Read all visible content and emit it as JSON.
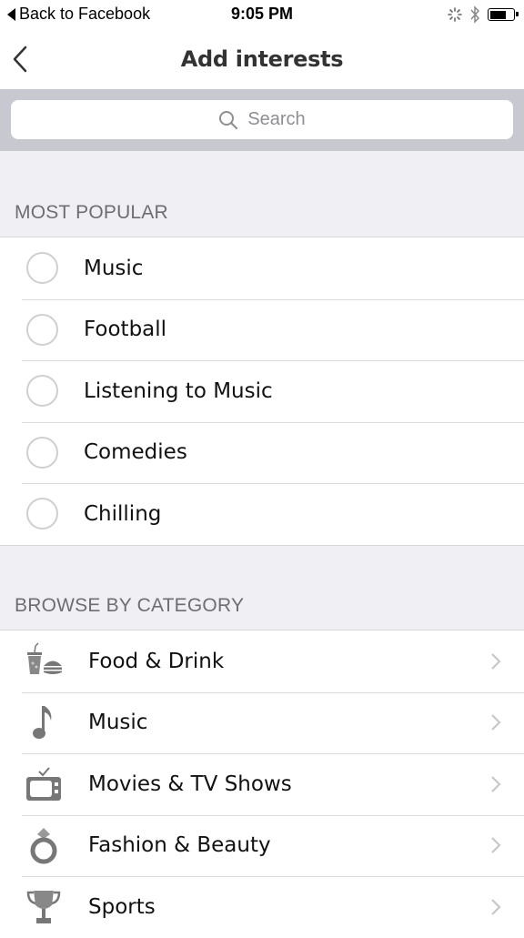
{
  "status_bar": {
    "back_app_label": "Back to Facebook",
    "time": "9:05 PM",
    "icons": [
      "activity-spinner-icon",
      "bluetooth-icon",
      "battery-icon"
    ]
  },
  "nav": {
    "back_icon": "chevron-left-icon",
    "title": "Add interests"
  },
  "search": {
    "placeholder": "Search",
    "icon": "search-icon"
  },
  "sections": {
    "most_popular": {
      "header": "MOST POPULAR",
      "items": [
        {
          "label": "Music",
          "selected": false
        },
        {
          "label": "Football",
          "selected": false
        },
        {
          "label": "Listening to Music",
          "selected": false
        },
        {
          "label": "Comedies",
          "selected": false
        },
        {
          "label": "Chilling",
          "selected": false
        }
      ]
    },
    "browse_by_category": {
      "header": "BROWSE BY CATEGORY",
      "items": [
        {
          "label": "Food & Drink",
          "icon": "food-drink-icon"
        },
        {
          "label": "Music",
          "icon": "music-note-icon"
        },
        {
          "label": "Movies & TV Shows",
          "icon": "tv-icon"
        },
        {
          "label": "Fashion & Beauty",
          "icon": "ring-icon"
        },
        {
          "label": "Sports",
          "icon": "trophy-icon"
        }
      ]
    }
  },
  "colors": {
    "background": "#efeff4",
    "search_bar_bg": "#c8c8d0",
    "icon_gray": "#7a7a7a",
    "chevron_gray": "#c7c7cc",
    "radio_border": "#cfcfd3"
  }
}
